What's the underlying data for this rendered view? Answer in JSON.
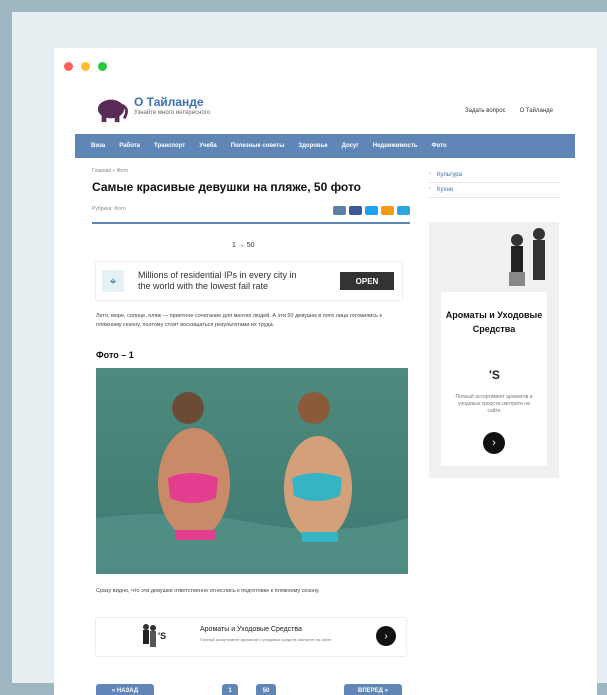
{
  "site": {
    "title": "О Тайланде",
    "tagline": "Узнайте много интересного",
    "top_links": [
      "Задать вопрос",
      "О Тайланде"
    ]
  },
  "nav": [
    "Виза",
    "Работа",
    "Транспорт",
    "Учеба",
    "Полезные советы",
    "Здоровье",
    "Досуг",
    "Недвижимость",
    "Фото"
  ],
  "article": {
    "breadcrumbs": "Главная » Фото",
    "title": "Самые красивые девушки на пляже, 50 фото",
    "rubric": "Рубрика: Фото",
    "pager_top": "1 → 50",
    "intro": "Лето, море, солнце, пляж — приятное сочетание для многих людей. А эти 50 девушек в поте лица готовились к пляжному сезону, поэтому стоит восхищаться результатами их труда.",
    "photo_title": "Фото – 1",
    "caption": "Сразу видно, что эти девушки ответственно отнеслись к подготовке к пляжному сезону.",
    "pager_bottom": {
      "prev": "« НАЗАД",
      "page1": "1",
      "page2": "50",
      "next": "ВПЕРЕД »"
    }
  },
  "ads": {
    "ad1": {
      "text": "Millions of residential IPs in every city in the world with the lowest fail rate",
      "button": "OPEN"
    },
    "ad2": {
      "brand": "'S",
      "title": "Ароматы и Уходовые Средства",
      "desc": "Полный ассортимент ароматов и уходовых средств смотрите на сайте"
    },
    "side": {
      "title": "Ароматы и Уходовые Средства",
      "brand": "'S",
      "desc": "Полный ассортимент ароматов и уходовых средств смотрите на сайте"
    }
  },
  "sidebar": {
    "links": [
      "Культура",
      "Кухня"
    ]
  },
  "colors": {
    "nav": "#5f86b6",
    "link": "#3b6fb2",
    "dot_red": "#ff5f57",
    "dot_yellow": "#febc2e",
    "dot_green": "#28c840"
  }
}
